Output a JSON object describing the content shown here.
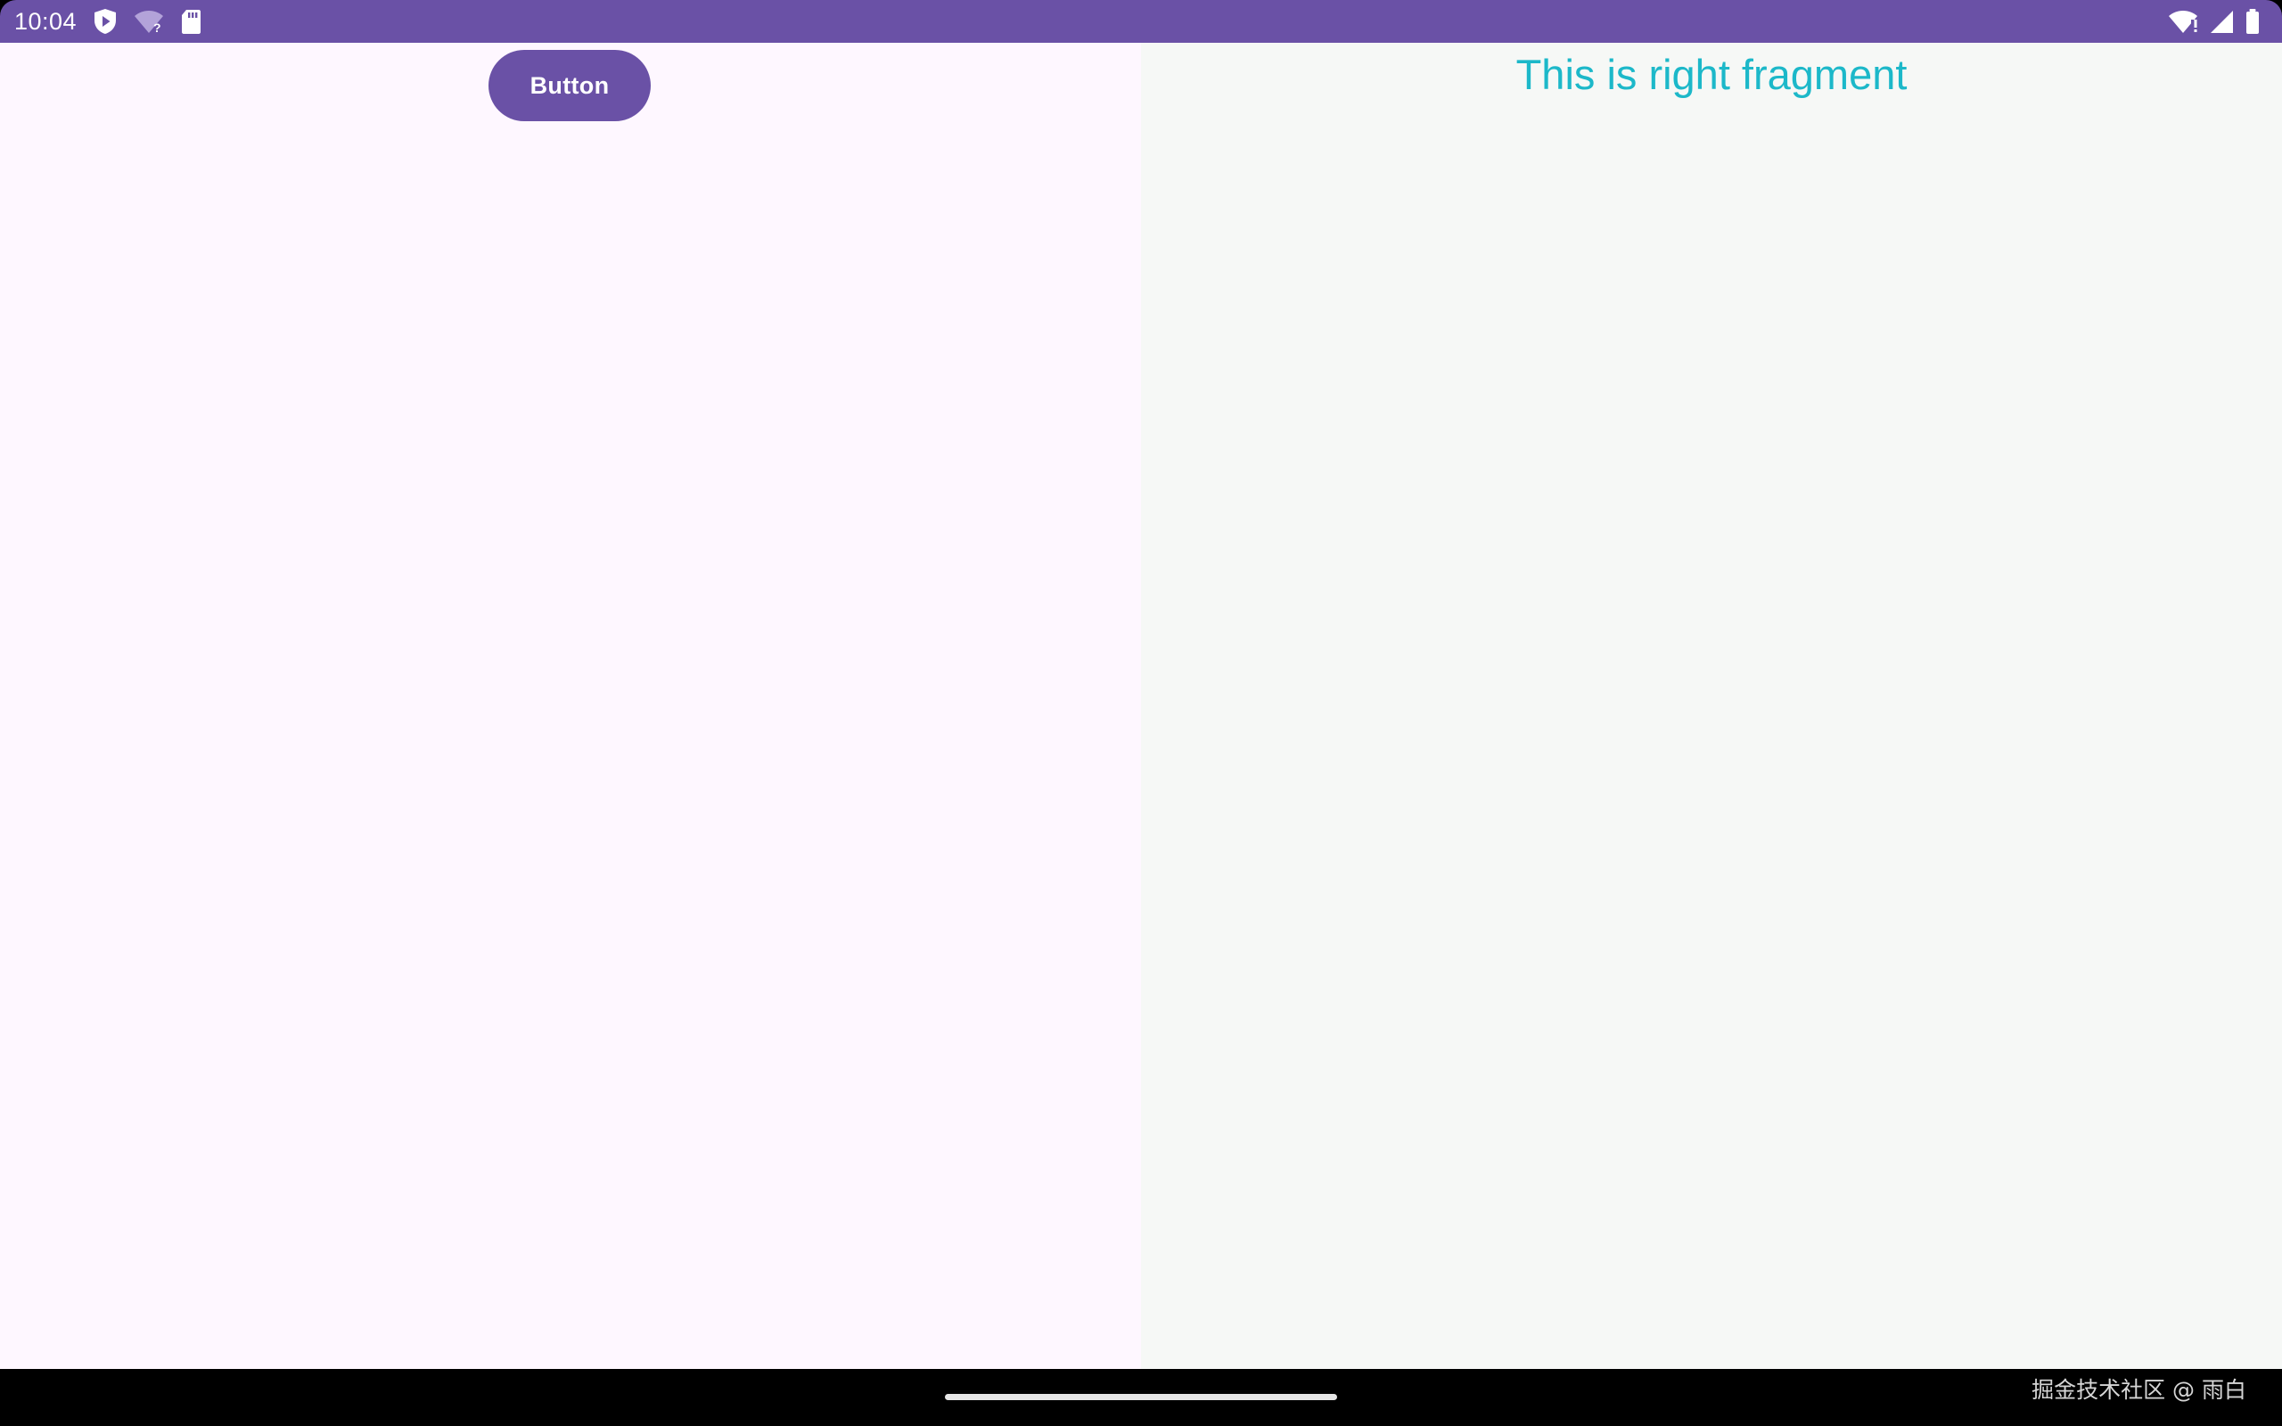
{
  "status_bar": {
    "time": "10:04",
    "left_icons": [
      "shield-play-icon",
      "wifi-unknown-icon",
      "sd-card-icon"
    ],
    "right_icons": [
      "wifi-alert-icon",
      "cell-signal-icon",
      "battery-icon"
    ],
    "color": "#6a51a6"
  },
  "left_fragment": {
    "button_label": "Button",
    "background": "#fef7ff"
  },
  "right_fragment": {
    "text": "This is right fragment",
    "text_color": "#1cb8c9",
    "background": "#f6f8f6"
  },
  "nav_bar": {
    "watermark": "掘金技术社区 @ 雨白"
  }
}
